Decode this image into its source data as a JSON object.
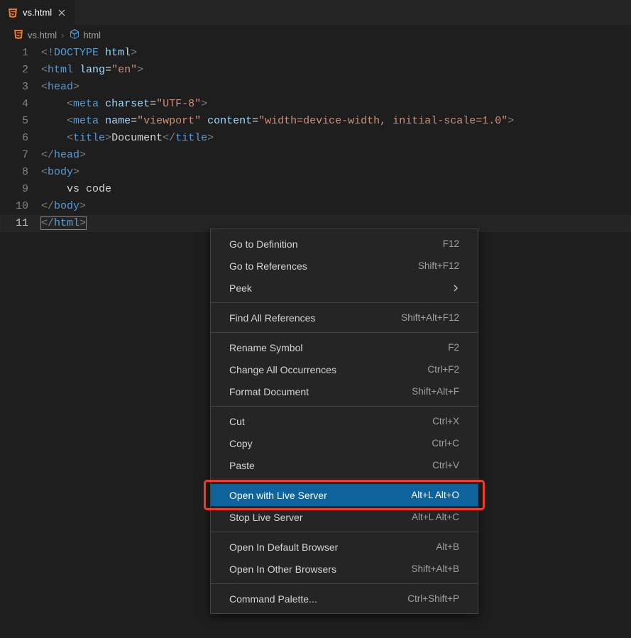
{
  "tab": {
    "filename": "vs.html"
  },
  "breadcrumb": {
    "items": [
      {
        "label": "vs.html",
        "icon": "file-html"
      },
      {
        "label": "html",
        "icon": "symbol-field"
      }
    ],
    "sep": "›"
  },
  "code": {
    "lines": [
      "1",
      "2",
      "3",
      "4",
      "5",
      "6",
      "7",
      "8",
      "9",
      "10",
      "11"
    ],
    "l1_a": "<!",
    "l1_b": "DOCTYPE",
    "l1_c": " ",
    "l1_d": "html",
    "l1_e": ">",
    "l2_a": "<",
    "l2_b": "html",
    "l2_c": " ",
    "l2_d": "lang",
    "l2_e": "=",
    "l2_f": "\"en\"",
    "l2_g": ">",
    "l3_a": "<",
    "l3_b": "head",
    "l3_c": ">",
    "l4_a": "<",
    "l4_b": "meta",
    "l4_c": " ",
    "l4_d": "charset",
    "l4_e": "=",
    "l4_f": "\"UTF-8\"",
    "l4_g": ">",
    "l5_a": "<",
    "l5_b": "meta",
    "l5_c": " ",
    "l5_d": "name",
    "l5_e": "=",
    "l5_f": "\"viewport\"",
    "l5_g": " ",
    "l5_h": "content",
    "l5_i": "=",
    "l5_j": "\"width=device-width, initial-scale=1.0\"",
    "l5_k": ">",
    "l6_a": "<",
    "l6_b": "title",
    "l6_c": ">",
    "l6_d": "Document",
    "l6_e": "</",
    "l6_f": "title",
    "l6_g": ">",
    "l7_a": "</",
    "l7_b": "head",
    "l7_c": ">",
    "l8_a": "<",
    "l8_b": "body",
    "l8_c": ">",
    "l9_a": "vs code",
    "l10_a": "</",
    "l10_b": "body",
    "l10_c": ">",
    "l11_a": "</",
    "l11_b": "html",
    "l11_c": ">"
  },
  "menu": {
    "items": [
      {
        "label": "Go to Definition",
        "kb": "F12",
        "type": "item"
      },
      {
        "label": "Go to References",
        "kb": "Shift+F12",
        "type": "item"
      },
      {
        "label": "Peek",
        "kb": "",
        "type": "submenu"
      },
      {
        "type": "sep"
      },
      {
        "label": "Find All References",
        "kb": "Shift+Alt+F12",
        "type": "item"
      },
      {
        "type": "sep"
      },
      {
        "label": "Rename Symbol",
        "kb": "F2",
        "type": "item"
      },
      {
        "label": "Change All Occurrences",
        "kb": "Ctrl+F2",
        "type": "item"
      },
      {
        "label": "Format Document",
        "kb": "Shift+Alt+F",
        "type": "item"
      },
      {
        "type": "sep"
      },
      {
        "label": "Cut",
        "kb": "Ctrl+X",
        "type": "item"
      },
      {
        "label": "Copy",
        "kb": "Ctrl+C",
        "type": "item"
      },
      {
        "label": "Paste",
        "kb": "Ctrl+V",
        "type": "item"
      },
      {
        "type": "sep"
      },
      {
        "label": "Open with Live Server",
        "kb": "Alt+L Alt+O",
        "type": "item",
        "selected": true,
        "highlight": true
      },
      {
        "label": "Stop Live Server",
        "kb": "Alt+L Alt+C",
        "type": "item"
      },
      {
        "type": "sep"
      },
      {
        "label": "Open In Default Browser",
        "kb": "Alt+B",
        "type": "item"
      },
      {
        "label": "Open In Other Browsers",
        "kb": "Shift+Alt+B",
        "type": "item"
      },
      {
        "type": "sep"
      },
      {
        "label": "Command Palette...",
        "kb": "Ctrl+Shift+P",
        "type": "item"
      }
    ]
  }
}
